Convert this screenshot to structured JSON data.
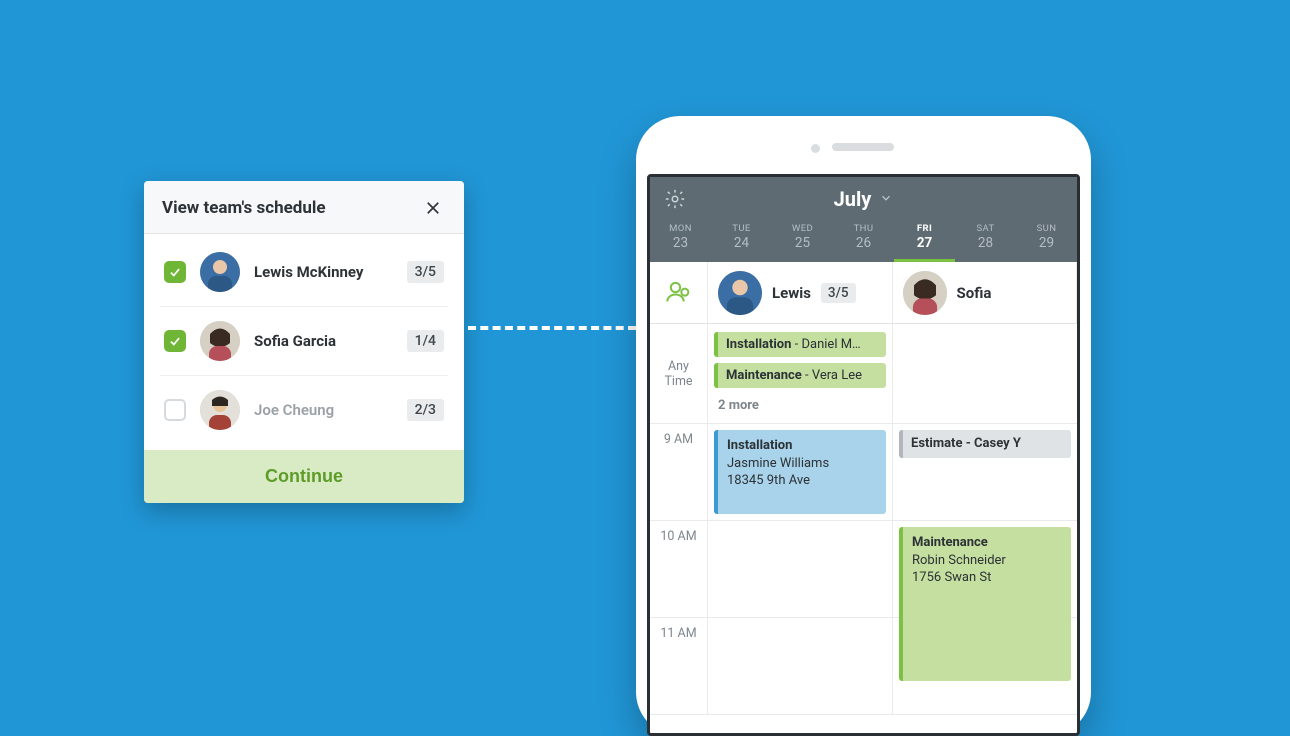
{
  "dialog": {
    "title": "View team's schedule",
    "continue": "Continue",
    "members": [
      {
        "name": "Lewis McKinney",
        "ratio": "3/5",
        "checked": true,
        "muted": false
      },
      {
        "name": "Sofia Garcia",
        "ratio": "1/4",
        "checked": true,
        "muted": false
      },
      {
        "name": "Joe Cheung",
        "ratio": "2/3",
        "checked": false,
        "muted": true
      }
    ]
  },
  "calendar": {
    "month": "July",
    "days": [
      {
        "dow": "MON",
        "num": "23"
      },
      {
        "dow": "TUE",
        "num": "24"
      },
      {
        "dow": "WED",
        "num": "25"
      },
      {
        "dow": "THU",
        "num": "26"
      },
      {
        "dow": "FRI",
        "num": "27",
        "selected": true
      },
      {
        "dow": "SAT",
        "num": "28"
      },
      {
        "dow": "SUN",
        "num": "29"
      }
    ],
    "people": [
      {
        "name": "Lewis",
        "ratio": "3/5"
      },
      {
        "name": "Sofia"
      }
    ],
    "anytime_label_1": "Any",
    "anytime_label_2": "Time",
    "anytime": {
      "lewis": [
        {
          "type": "Installation",
          "who": "Daniel M…"
        },
        {
          "type": "Maintenance",
          "who": "Vera Lee"
        }
      ],
      "more": "2 more"
    },
    "hours": {
      "h9": "9 AM",
      "h10": "10 AM",
      "h11": "11 AM"
    },
    "events": {
      "lewis_9": {
        "title": "Installation",
        "line1": "Jasmine Williams",
        "line2": "18345 9th Ave"
      },
      "sofia_9": {
        "combined": "Estimate - Casey Y"
      },
      "sofia_10": {
        "title": "Maintenance",
        "line1": "Robin Schneider",
        "line2": "1756 Swan St"
      }
    }
  }
}
